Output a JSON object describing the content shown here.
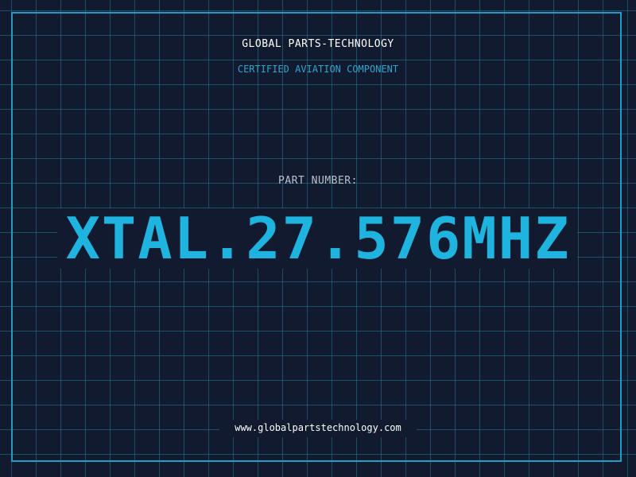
{
  "header": {
    "company": "GLOBAL PARTS-TECHNOLOGY",
    "tagline": "CERTIFIED AVIATION COMPONENT"
  },
  "part": {
    "label": "PART NUMBER:",
    "number": "XTAL.27.576MHZ"
  },
  "footer": {
    "url": "www.globalpartstechnology.com"
  },
  "colors": {
    "background": "#111a2e",
    "grid": "#267a96",
    "frame": "#1c9fc7",
    "accent": "#1fb4e0"
  }
}
